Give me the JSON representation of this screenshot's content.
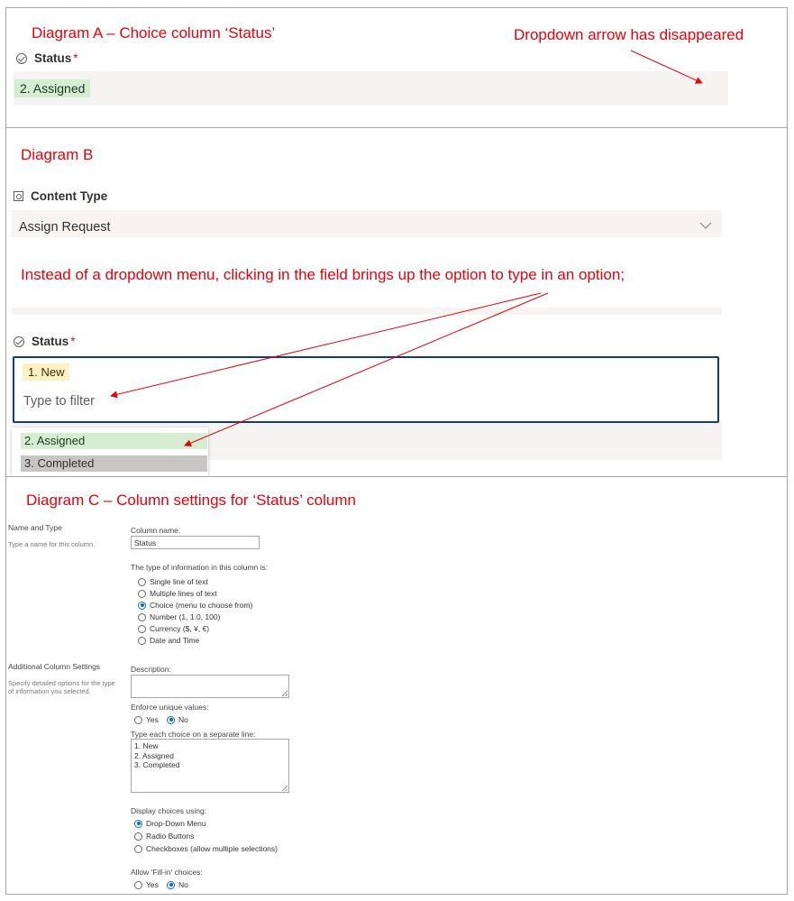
{
  "diagram_a": {
    "title": "Diagram A – Choice column ‘Status’",
    "annotation": "Dropdown arrow has disappeared",
    "status_label": "Status",
    "required_mark": "*",
    "selected_value": "2. Assigned",
    "selected_color": "#d6ecd3"
  },
  "diagram_b": {
    "title": "Diagram B",
    "content_type_label": "Content Type",
    "content_type_value": "Assign Request",
    "annotation": "Instead of a dropdown menu, clicking in the field brings up the option to type in an option;",
    "status_label": "Status",
    "required_mark": "*",
    "selected_value": "1. New",
    "selected_color": "#fff1c4",
    "filter_placeholder": "Type to filter",
    "options": [
      "2. Assigned",
      "3. Completed"
    ],
    "option_colors": [
      "#d6ecd3",
      "#c8c6c4"
    ],
    "focus_border_color": "#123d6e"
  },
  "diagram_c": {
    "title": "Diagram C – Column settings for ‘Status’ column",
    "name_type": {
      "heading": "Name and Type",
      "help": "Type a name for this column.",
      "column_name_label": "Column name:",
      "column_name_value": "Status",
      "type_label": "The type of information in this column is:",
      "types": [
        {
          "label": "Single line of text",
          "selected": false
        },
        {
          "label": "Multiple lines of text",
          "selected": false
        },
        {
          "label": "Choice (menu to choose from)",
          "selected": true
        },
        {
          "label": "Number (1, 1.0, 100)",
          "selected": false
        },
        {
          "label": "Currency ($, ¥, €)",
          "selected": false
        },
        {
          "label": "Date and Time",
          "selected": false
        }
      ]
    },
    "additional": {
      "heading": "Additional Column Settings",
      "help": "Specify detailed options for the type of information you selected.",
      "description_label": "Description:",
      "description_value": "",
      "enforce_label": "Enforce unique values:",
      "enforce_yes": "Yes",
      "enforce_no": "No",
      "choices_label": "Type each choice on a separate line:",
      "choices": [
        "1. New",
        "2. Assigned",
        "3. Completed"
      ],
      "display_label": "Display choices using:",
      "display_options": [
        {
          "label": "Drop-Down Menu",
          "selected": true
        },
        {
          "label": "Radio Buttons",
          "selected": false
        },
        {
          "label": "Checkboxes (allow multiple selections)",
          "selected": false
        }
      ],
      "fillin_label": "Allow 'Fill-in' choices:",
      "fillin_yes": "Yes",
      "fillin_no": "No"
    }
  },
  "annotation_color": "#e8000b",
  "radio_selected_color": "#0f6cbd"
}
